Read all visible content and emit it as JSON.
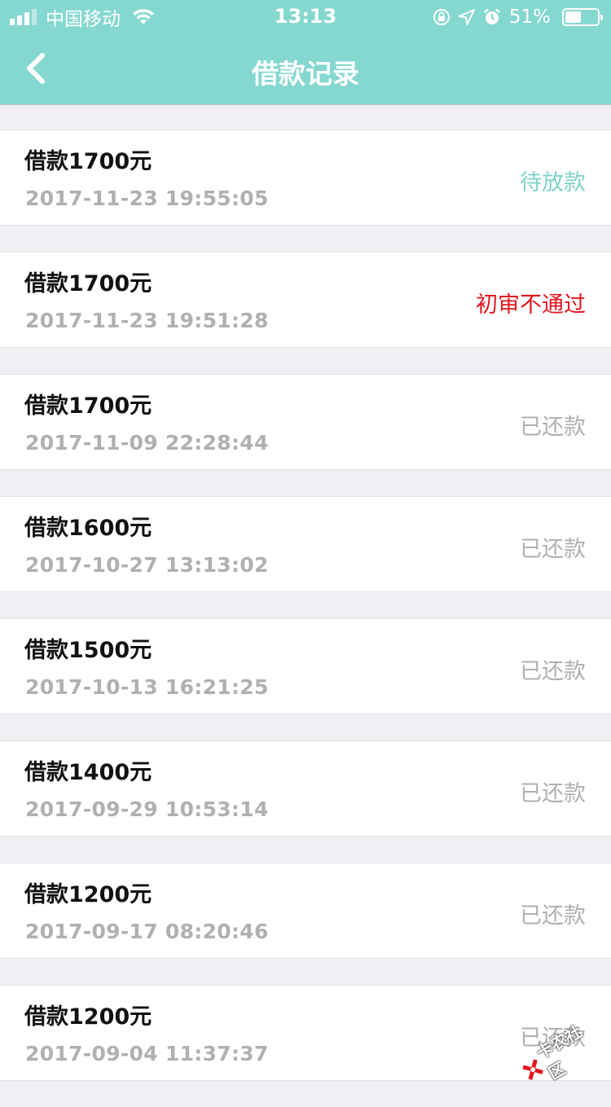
{
  "status_bar": {
    "carrier": "中国移动",
    "time": "13:13",
    "battery_percent": "51%",
    "battery_level": 0.51
  },
  "nav": {
    "title": "借款记录"
  },
  "colors": {
    "header_bg": "#85d8d0",
    "status_pending": "#7fd4cb",
    "status_rejected": "#e6141e",
    "status_repaid": "#b0b0b0"
  },
  "records": [
    {
      "title": "借款1700元",
      "time": "2017-11-23 19:55:05",
      "status": "待放款",
      "status_color": "#7fd4cb"
    },
    {
      "title": "借款1700元",
      "time": "2017-11-23 19:51:28",
      "status": "初审不通过",
      "status_color": "#e6141e"
    },
    {
      "title": "借款1700元",
      "time": "2017-11-09 22:28:44",
      "status": "已还款",
      "status_color": "#b0b0b0"
    },
    {
      "title": "借款1600元",
      "time": "2017-10-27 13:13:02",
      "status": "已还款",
      "status_color": "#b0b0b0"
    },
    {
      "title": "借款1500元",
      "time": "2017-10-13 16:21:25",
      "status": "已还款",
      "status_color": "#b0b0b0"
    },
    {
      "title": "借款1400元",
      "time": "2017-09-29 10:53:14",
      "status": "已还款",
      "status_color": "#b0b0b0"
    },
    {
      "title": "借款1200元",
      "time": "2017-09-17 08:20:46",
      "status": "已还款",
      "status_color": "#b0b0b0"
    },
    {
      "title": "借款1200元",
      "time": "2017-09-04 11:37:37",
      "status": "已还款",
      "status_color": "#b0b0b0"
    }
  ],
  "watermark": {
    "text": "卡农社区"
  }
}
